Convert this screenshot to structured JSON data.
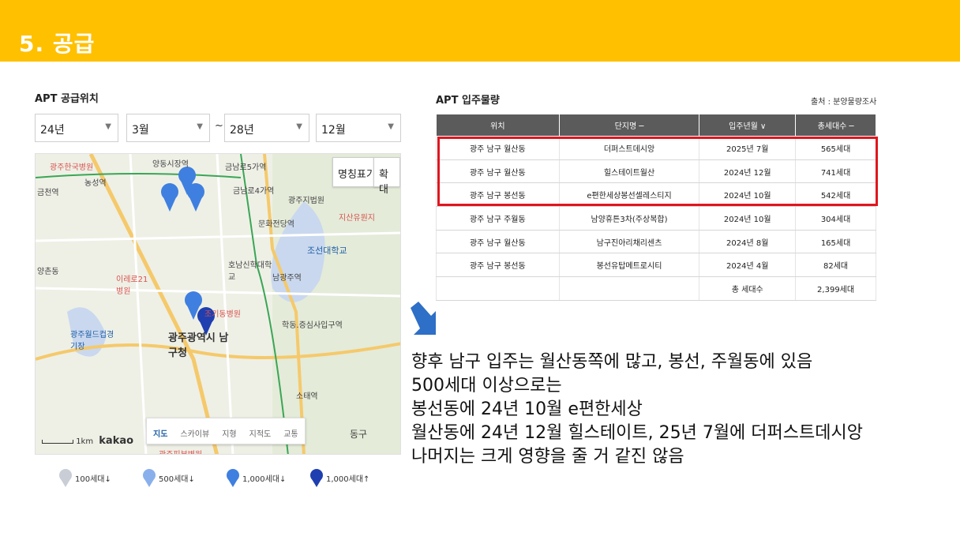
{
  "header": {
    "title": "5. 공급"
  },
  "left_panel": {
    "title": "APT 공급위치",
    "filters": {
      "start_year": "24년",
      "start_month": "3월",
      "separator": "~",
      "end_year": "28년",
      "end_month": "12월"
    },
    "map": {
      "buttons": {
        "labels": "명칭표기",
        "zoom": "확대"
      },
      "labels": [
        "광주한국병원",
        "양동시장역",
        "금남로5가역",
        "금남로4가역",
        "문화전당역",
        "광주지법원",
        "지산유원지",
        "조선대학교",
        "호남신학대학교",
        "남광주역",
        "이레로21병원",
        "조기동병원",
        "광주월드컵경기장",
        "광주광역시 남구청",
        "학동.증심사입구역",
        "소태역",
        "동구",
        "광주피부병원",
        "농성역",
        "금천역",
        "양촌동"
      ],
      "tabs": [
        "지도",
        "스카이뷰",
        "지형",
        "지적도",
        "교통"
      ],
      "scale": "1km",
      "brand": "kakao"
    },
    "legend": [
      {
        "label": "100세대↓",
        "color": "#c9cdd6"
      },
      {
        "label": "500세대↓",
        "color": "#8ab0ec"
      },
      {
        "label": "1,000세대↓",
        "color": "#3f7fe0"
      },
      {
        "label": "1,000세대↑",
        "color": "#1f3fb0"
      }
    ]
  },
  "right_panel": {
    "title": "APT 입주물량",
    "source": "출처 : 분양물량조사",
    "columns": [
      "위치",
      "단지명 ─",
      "입주년월 ∨",
      "총세대수 ─"
    ],
    "rows": [
      [
        "광주 남구 월산동",
        "더퍼스트데시앙",
        "2025년 7월",
        "565세대"
      ],
      [
        "광주 남구 월산동",
        "힐스테이트월산",
        "2024년 12월",
        "741세대"
      ],
      [
        "광주 남구 봉선동",
        "e편한세상봉선셀레스티지",
        "2024년 10월",
        "542세대"
      ],
      [
        "광주 남구 주월동",
        "남양휴튼3차(주상복합)",
        "2024년 10월",
        "304세대"
      ],
      [
        "광주 남구 월산동",
        "남구진아리채리센츠",
        "2024년 8월",
        "165세대"
      ],
      [
        "광주 남구 봉선동",
        "봉선유탑메트로시티",
        "2024년 4월",
        "82세대"
      ]
    ],
    "total": {
      "label": "총 세대수",
      "value": "2,399세대"
    },
    "highlight_color": "#e0161f"
  },
  "notes": [
    "향후 남구 입주는 월산동쪽에 많고, 봉선, 주월동에 있음",
    "500세대 이상으로는",
    "봉선동에 24년 10월 e편한세상",
    "월산동에 24년 12월 힐스테이트, 25년 7월에 더퍼스트데시앙",
    "나머지는 크게 영향을 줄 거 같진 않음"
  ]
}
